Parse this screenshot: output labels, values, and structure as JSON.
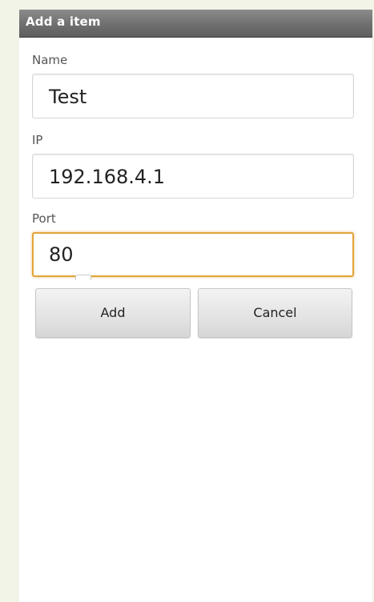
{
  "dialog": {
    "title": "Add a item"
  },
  "fields": {
    "name": {
      "label": "Name",
      "value": "Test"
    },
    "ip": {
      "label": "IP",
      "value": "192.168.4.1"
    },
    "port": {
      "label": "Port",
      "value": "80"
    }
  },
  "buttons": {
    "add_label": "Add",
    "cancel_label": "Cancel"
  },
  "colors": {
    "title_bar": "#6f6f6f",
    "focus_border": "#e2a53a",
    "page_background": "#f1f4e6"
  }
}
